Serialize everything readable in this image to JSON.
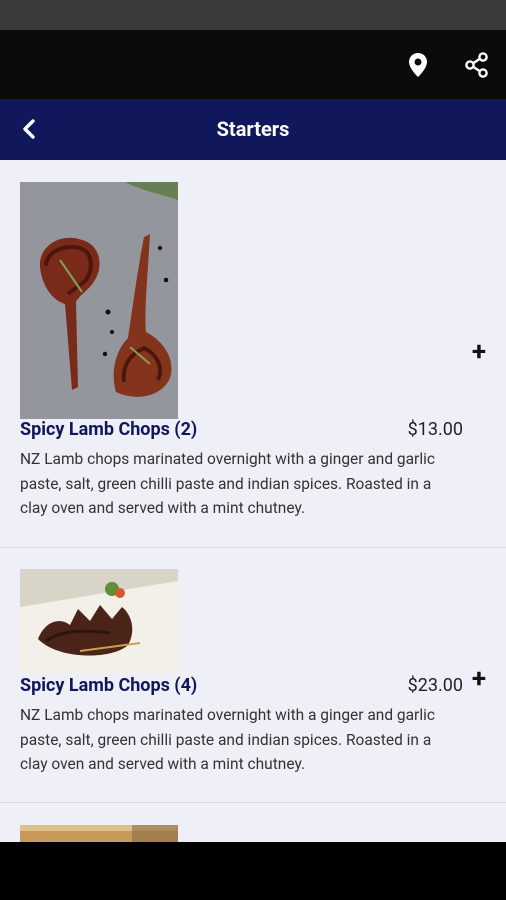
{
  "header": {
    "title": "Starters",
    "icons": {
      "back": "chevron-left-icon",
      "location": "map-pin-icon",
      "share": "share-icon"
    }
  },
  "items": [
    {
      "name": "Spicy Lamb Chops (2)",
      "price": "$13.00",
      "description": "NZ Lamb chops marinated overnight with a ginger and garlic paste, salt, green chilli paste and indian spices. Roasted in a clay oven and served with a mint chutney.",
      "add_icon": "plus-icon"
    },
    {
      "name": "Spicy Lamb Chops (4)",
      "price": "$23.00",
      "description": "NZ Lamb chops marinated overnight with a ginger and garlic paste, salt, green chilli paste and indian spices. Roasted in a clay oven and served with a mint chutney.",
      "add_icon": "plus-icon"
    }
  ],
  "colors": {
    "title_bar": "#10185b",
    "app_bar": "#0b0b0b",
    "background": "#efeff7",
    "dish_name": "#10185b"
  }
}
